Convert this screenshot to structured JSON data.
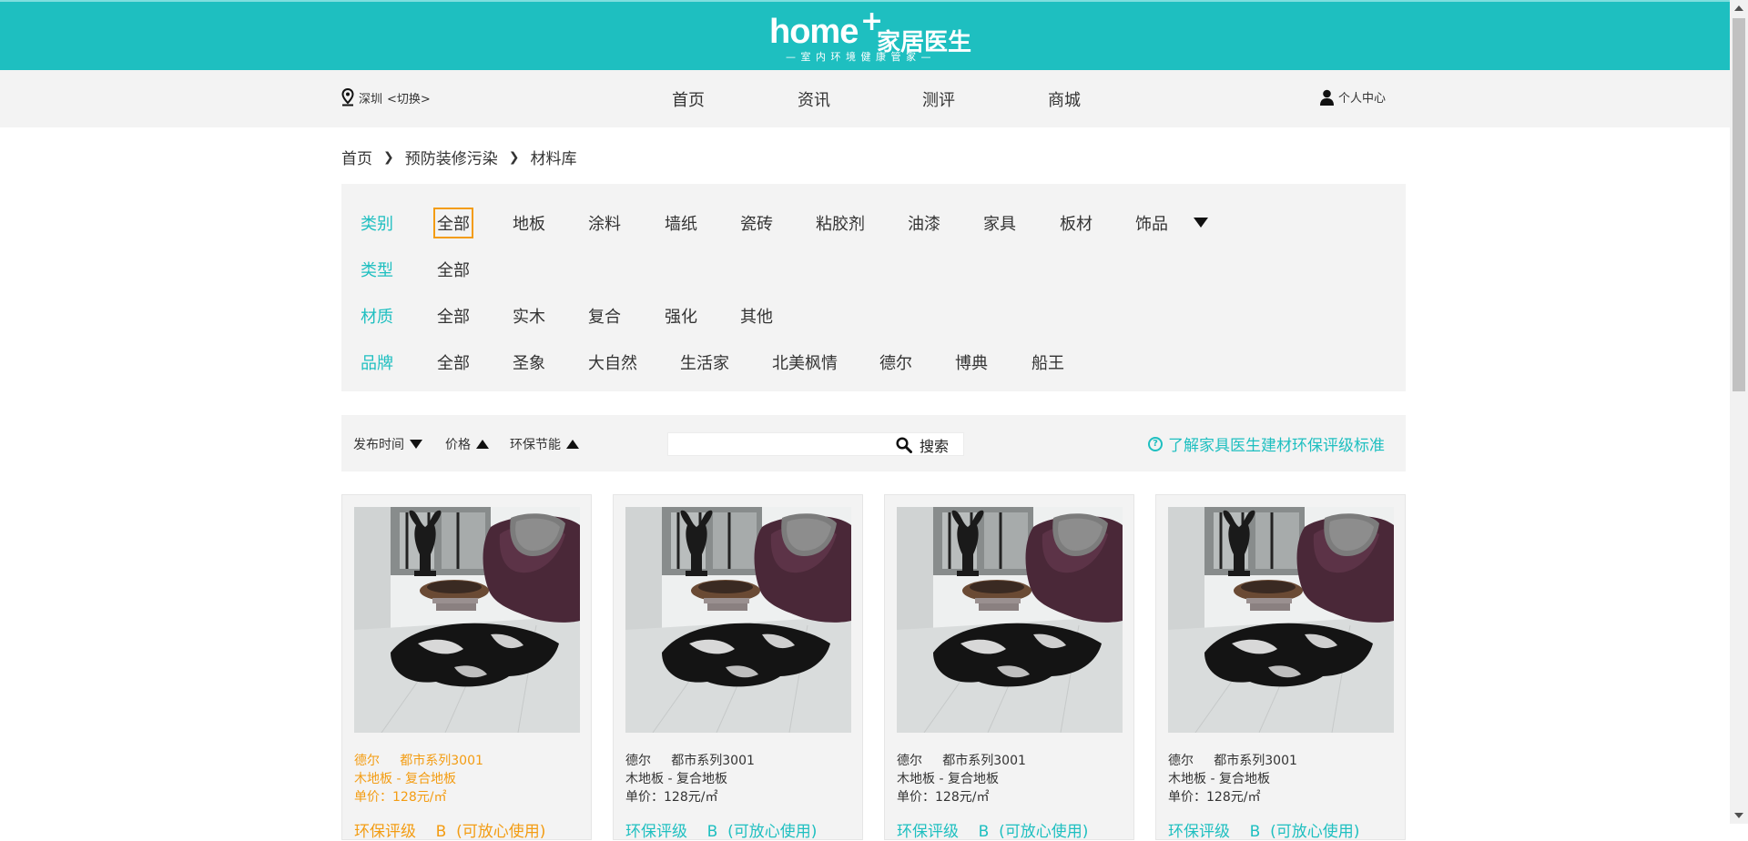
{
  "logo": {
    "main": "home",
    "plus": "+",
    "cn": "家居医生",
    "tagline": "— 室 内 环 境 健 康 管 家 —"
  },
  "location": {
    "city": "深圳",
    "switch": "<切换>"
  },
  "nav": [
    "首页",
    "资讯",
    "测评",
    "商城"
  ],
  "user": {
    "label": "个人中心"
  },
  "breadcrumb": [
    "首页",
    "预防装修污染",
    "材料库"
  ],
  "filters": {
    "category": {
      "label": "类别",
      "options": [
        "全部",
        "地板",
        "涂料",
        "墙纸",
        "瓷砖",
        "粘胶剂",
        "油漆",
        "家具",
        "板材",
        "饰品"
      ],
      "selected": "全部"
    },
    "type": {
      "label": "类型",
      "options": [
        "全部"
      ]
    },
    "material": {
      "label": "材质",
      "options": [
        "全部",
        "实木",
        "复合",
        "强化",
        "其他"
      ]
    },
    "brand": {
      "label": "品牌",
      "options": [
        "全部",
        "圣象",
        "大自然",
        "生活家",
        "北美枫情",
        "德尔",
        "博典",
        "船王"
      ]
    }
  },
  "sort": {
    "publish_time": "发布时间",
    "price": "价格",
    "eco": "环保节能"
  },
  "search": {
    "placeholder": "",
    "button": "搜索"
  },
  "standard_link": "了解家具医生建材环保评级标准",
  "products": [
    {
      "brand": "德尔",
      "series": "都市系列3001",
      "category": "木地板 - 复合地板",
      "price": "单价：128元/㎡",
      "rating": "环保评级",
      "rating_value": "B",
      "rating_note": "(可放心使用)",
      "highlighted": true
    },
    {
      "brand": "德尔",
      "series": "都市系列3001",
      "category": "木地板 - 复合地板",
      "price": "单价：128元/㎡",
      "rating": "环保评级",
      "rating_value": "B",
      "rating_note": "(可放心使用)",
      "highlighted": false
    },
    {
      "brand": "德尔",
      "series": "都市系列3001",
      "category": "木地板 - 复合地板",
      "price": "单价：128元/㎡",
      "rating": "环保评级",
      "rating_value": "B",
      "rating_note": "(可放心使用)",
      "highlighted": false
    },
    {
      "brand": "德尔",
      "series": "都市系列3001",
      "category": "木地板 - 复合地板",
      "price": "单价：128元/㎡",
      "rating": "环保评级",
      "rating_value": "B",
      "rating_note": "(可放心使用)",
      "highlighted": false
    }
  ],
  "colors": {
    "brand": "#1ebfc0",
    "highlight": "#f39c12",
    "panel": "#f3f3f3"
  }
}
